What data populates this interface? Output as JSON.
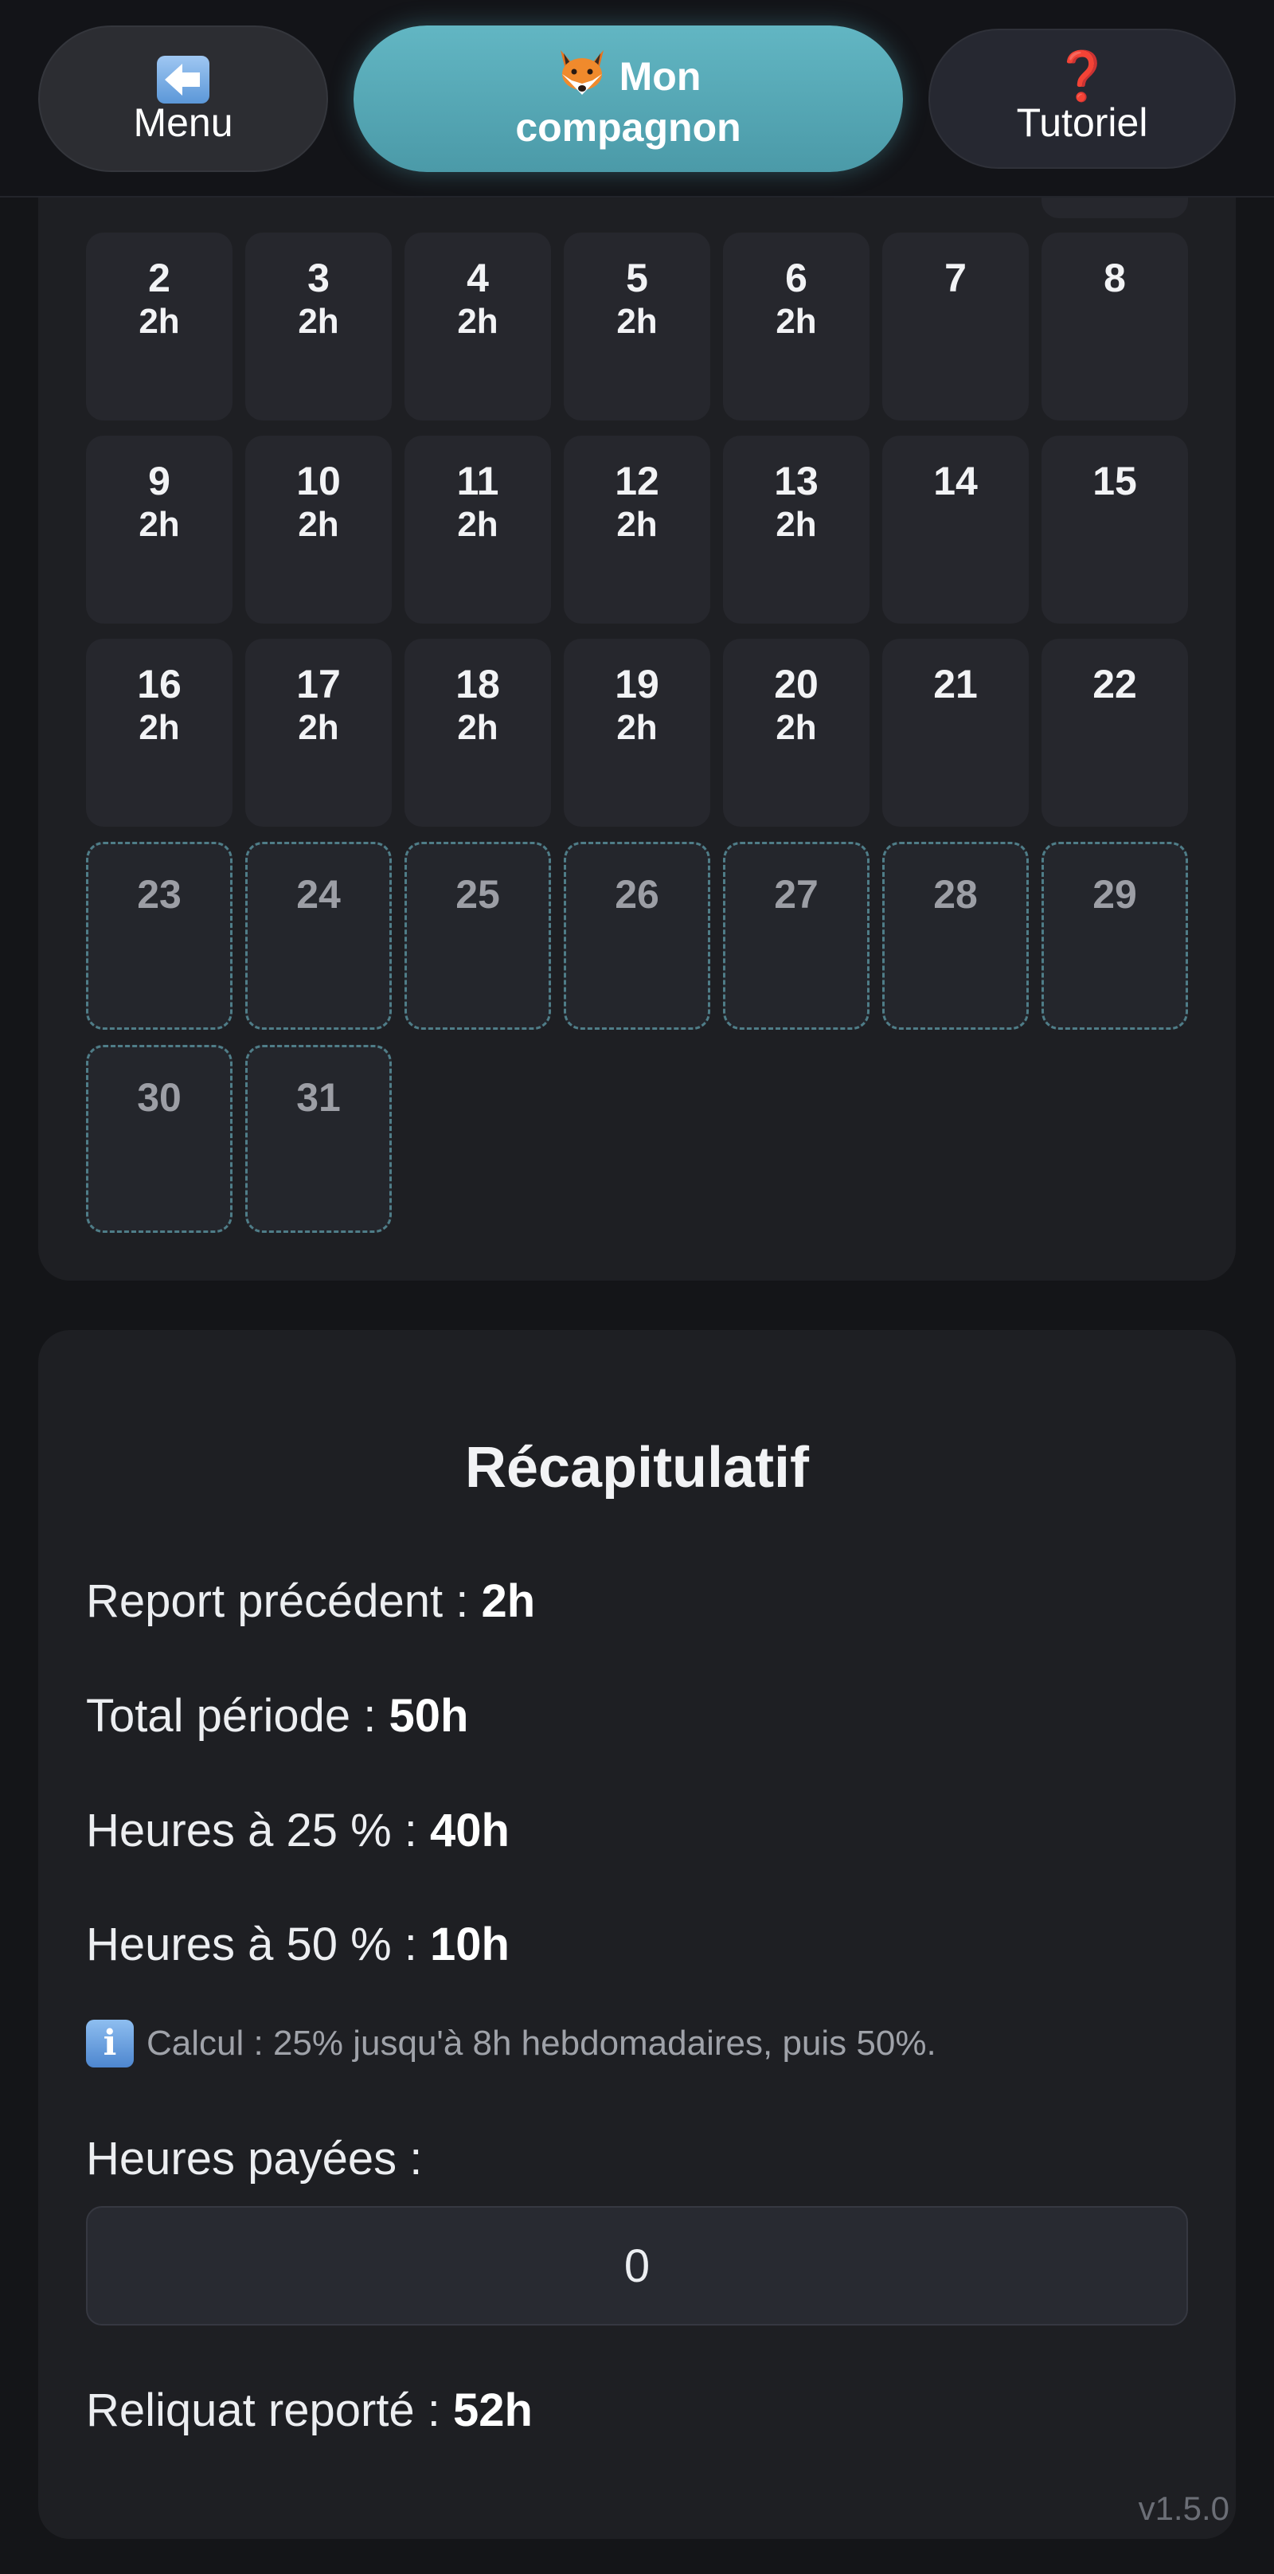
{
  "header": {
    "menu_label": "Menu",
    "menu_icon": "back-arrow-icon",
    "companion_line1": "Mon",
    "companion_line2": "compagnon",
    "companion_icon": "fox-icon",
    "tutorial_label": "Tutoriel",
    "tutorial_icon": "question-mark-icon",
    "colors": {
      "accent": "#55a9b6",
      "card": "#1e1f23",
      "background": "#141518"
    }
  },
  "calendar": {
    "weeks": [
      [
        {
          "day": "2",
          "hours": "2h"
        },
        {
          "day": "3",
          "hours": "2h"
        },
        {
          "day": "4",
          "hours": "2h"
        },
        {
          "day": "5",
          "hours": "2h"
        },
        {
          "day": "6",
          "hours": "2h"
        },
        {
          "day": "7",
          "hours": ""
        },
        {
          "day": "8",
          "hours": ""
        }
      ],
      [
        {
          "day": "9",
          "hours": "2h"
        },
        {
          "day": "10",
          "hours": "2h"
        },
        {
          "day": "11",
          "hours": "2h"
        },
        {
          "day": "12",
          "hours": "2h"
        },
        {
          "day": "13",
          "hours": "2h"
        },
        {
          "day": "14",
          "hours": ""
        },
        {
          "day": "15",
          "hours": ""
        }
      ],
      [
        {
          "day": "16",
          "hours": "2h"
        },
        {
          "day": "17",
          "hours": "2h"
        },
        {
          "day": "18",
          "hours": "2h"
        },
        {
          "day": "19",
          "hours": "2h"
        },
        {
          "day": "20",
          "hours": "2h"
        },
        {
          "day": "21",
          "hours": ""
        },
        {
          "day": "22",
          "hours": ""
        }
      ],
      [
        {
          "day": "23",
          "hours": "",
          "future": true
        },
        {
          "day": "24",
          "hours": "",
          "future": true
        },
        {
          "day": "25",
          "hours": "",
          "future": true
        },
        {
          "day": "26",
          "hours": "",
          "future": true
        },
        {
          "day": "27",
          "hours": "",
          "future": true
        },
        {
          "day": "28",
          "hours": "",
          "future": true
        },
        {
          "day": "29",
          "hours": "",
          "future": true
        }
      ],
      [
        {
          "day": "30",
          "hours": "",
          "future": true
        },
        {
          "day": "31",
          "hours": "",
          "future": true
        }
      ]
    ]
  },
  "summary": {
    "title": "Récapitulatif",
    "previous_label": "Report précédent : ",
    "previous_value": "2h",
    "total_label": "Total période : ",
    "total_value": "50h",
    "h25_label": "Heures à 25 % : ",
    "h25_value": "40h",
    "h50_label": "Heures à 50 % : ",
    "h50_value": "10h",
    "info_icon": "info-icon",
    "info_text": "Calcul : 25% jusqu'à 8h hebdomadaires, puis 50%.",
    "paid_label": "Heures payées :",
    "paid_value": "0",
    "remainder_label": "Reliquat reporté : ",
    "remainder_value": "52h"
  },
  "version": "v1.5.0"
}
